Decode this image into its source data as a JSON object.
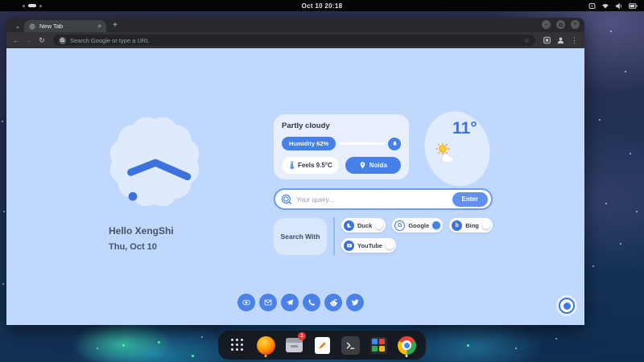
{
  "system_bar": {
    "clock": "Oct 10 20:18",
    "status_icons": [
      "keyboard-indicator",
      "wifi",
      "volume",
      "battery"
    ]
  },
  "browser": {
    "tab_title": "New Tab",
    "new_tab_glyph": "+",
    "tab_close_glyph": "×",
    "tab_search_glyph": "⌄",
    "window_controls": {
      "minimize": "–",
      "close": "×"
    },
    "nav": {
      "back": "←",
      "forward": "→",
      "refresh": "↻"
    },
    "address_bar_placeholder": "Search Google or type a URL",
    "favicon_letter": "G",
    "bookmark_star": "☆",
    "menu_glyph": "⋮"
  },
  "ntp": {
    "greeting": "Hello XengShi",
    "date": "Thu, Oct 10",
    "weather": {
      "condition": "Partly cloudy",
      "humidity": "Humidity 62%",
      "feels": "Feels 9.5°C",
      "location": "Noida",
      "temperature": "11°"
    },
    "search": {
      "placeholder": "Your query...",
      "enter": "Enter",
      "search_with": "Search With",
      "google_glyph": "G",
      "bing_glyph": "b",
      "engines": [
        {
          "label": "Duck",
          "selected": false
        },
        {
          "label": "Google",
          "selected": true
        },
        {
          "label": "Bing",
          "selected": false
        },
        {
          "label": "YouTube",
          "selected": false
        }
      ]
    },
    "social_icons": [
      "youtube",
      "email",
      "telegram",
      "whatsapp",
      "reddit",
      "twitter"
    ]
  },
  "dock": {
    "apps": [
      "app-grid",
      "firefox",
      "archive-manager",
      "text-editor",
      "terminal",
      "app-tiles",
      "chrome"
    ],
    "badge": "1"
  },
  "colors": {
    "accent": "#4480e8",
    "page_bg": "#bfd8fb",
    "card_bg": "#e7effd",
    "blob_bg": "#dfeafd",
    "hand_blue": "#3b72dd"
  }
}
